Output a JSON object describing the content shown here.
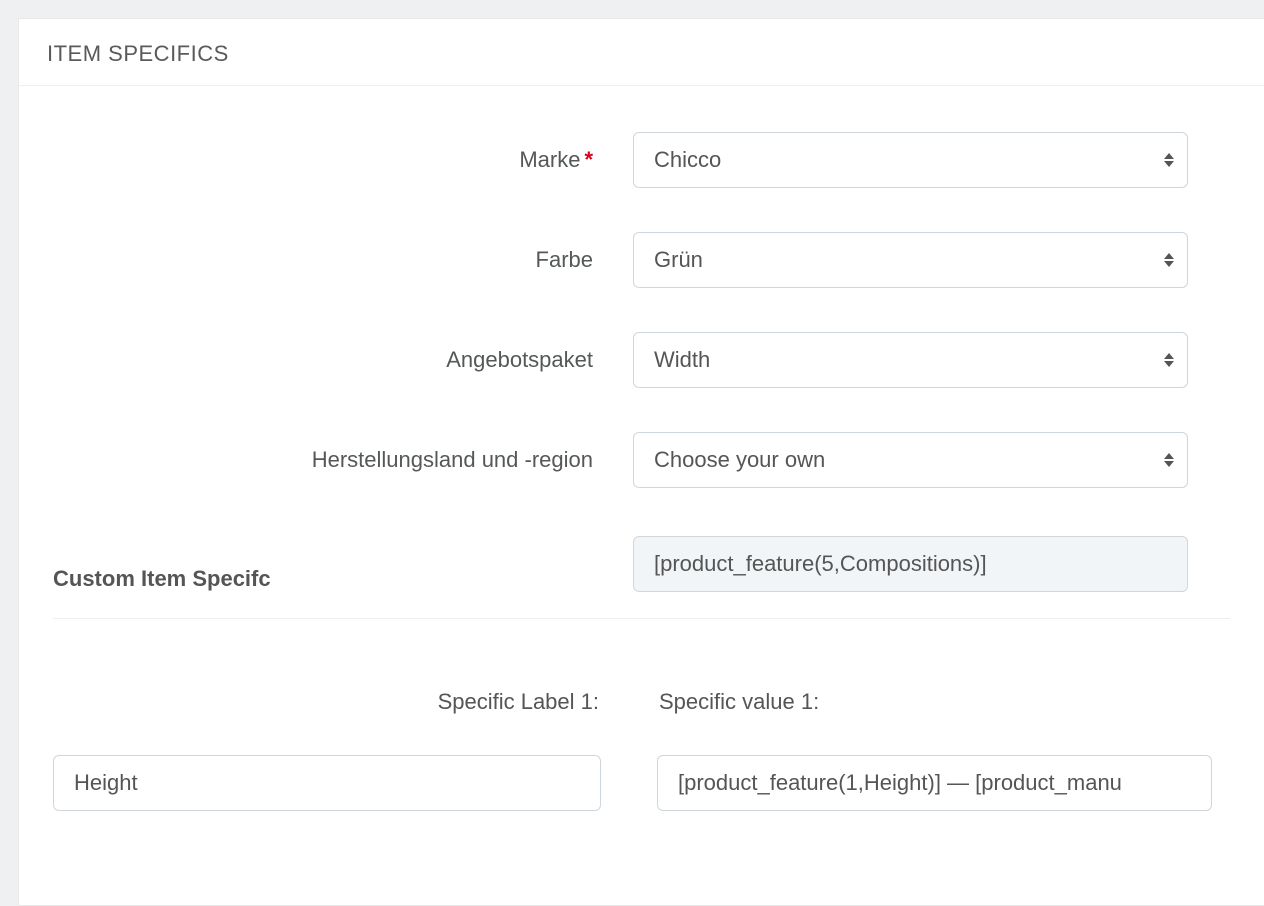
{
  "panel": {
    "title": "ITEM SPECIFICS",
    "subsection_title": "Custom Item Specifc"
  },
  "fields": {
    "marke": {
      "label": "Marke",
      "value": "Chicco",
      "required": true
    },
    "farbe": {
      "label": "Farbe",
      "value": "Grün"
    },
    "angebotspaket": {
      "label": "Angebotspaket",
      "value": "Width"
    },
    "herstellungsland": {
      "label": "Herstellungsland und -region",
      "value": "Choose your own"
    },
    "compositions_value": "[product_feature(5,Compositions)]"
  },
  "custom": {
    "label_heading": "Specific Label 1:",
    "value_heading": "Specific value 1:",
    "label_value": "Height",
    "value_value": "[product_feature(1,Height)] — [product_manu"
  }
}
